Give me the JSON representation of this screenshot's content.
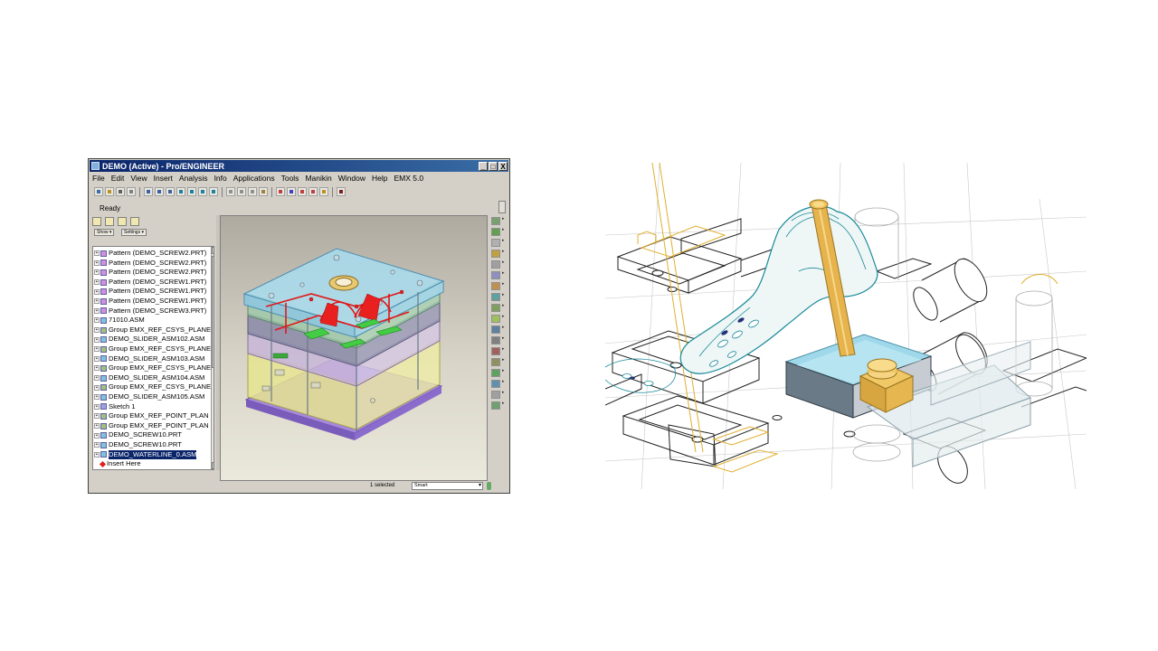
{
  "window": {
    "title": "DEMO (Active) - Pro/ENGINEER",
    "controls": {
      "minimize": "_",
      "maximize": "□",
      "close": "X"
    }
  },
  "menu": [
    "File",
    "Edit",
    "View",
    "Insert",
    "Analysis",
    "Info",
    "Applications",
    "Tools",
    "Manikin",
    "Window",
    "Help",
    "EMX 5.0"
  ],
  "status_message": "Ready",
  "panel": {
    "show_label": "Show ▾",
    "settings_label": "Settings ▾"
  },
  "tree": [
    {
      "label": "Pattern (DEMO_SCREW2.PRT)",
      "icon": "pattern-icon"
    },
    {
      "label": "Pattern (DEMO_SCREW2.PRT)",
      "icon": "pattern-icon"
    },
    {
      "label": "Pattern (DEMO_SCREW2.PRT)",
      "icon": "pattern-icon"
    },
    {
      "label": "Pattern (DEMO_SCREW1.PRT)",
      "icon": "pattern-icon"
    },
    {
      "label": "Pattern (DEMO_SCREW1.PRT)",
      "icon": "pattern-icon"
    },
    {
      "label": "Pattern (DEMO_SCREW1.PRT)",
      "icon": "pattern-icon"
    },
    {
      "label": "Pattern (DEMO_SCREW3.PRT)",
      "icon": "pattern-icon"
    },
    {
      "label": "71010.ASM",
      "icon": "assembly-icon"
    },
    {
      "label": "Group EMX_REF_CSYS_PLANE",
      "icon": "group-icon"
    },
    {
      "label": "DEMO_SLIDER_ASM102.ASM",
      "icon": "assembly-icon"
    },
    {
      "label": "Group EMX_REF_CSYS_PLANE",
      "icon": "group-icon"
    },
    {
      "label": "DEMO_SLIDER_ASM103.ASM",
      "icon": "assembly-icon"
    },
    {
      "label": "Group EMX_REF_CSYS_PLANE",
      "icon": "group-icon"
    },
    {
      "label": "DEMO_SLIDER_ASM104.ASM",
      "icon": "assembly-icon"
    },
    {
      "label": "Group EMX_REF_CSYS_PLANE",
      "icon": "group-icon"
    },
    {
      "label": "DEMO_SLIDER_ASM105.ASM",
      "icon": "assembly-icon"
    },
    {
      "label": "Sketch 1",
      "icon": "sketch-icon"
    },
    {
      "label": "Group EMX_REF_POINT_PLAN",
      "icon": "group-icon"
    },
    {
      "label": "Group EMX_REF_POINT_PLAN",
      "icon": "group-icon"
    },
    {
      "label": "DEMO_SCREW10.PRT",
      "icon": "part-icon"
    },
    {
      "label": "DEMO_SCREW10.PRT",
      "icon": "part-icon"
    },
    {
      "label": "DEMO_WATERLINE_0.ASM",
      "icon": "assembly-icon",
      "selected": true
    },
    {
      "label": "Insert Here",
      "icon": "insert-here-icon"
    }
  ],
  "statusbar": {
    "selected": "1 selected",
    "filter": "Smart"
  },
  "colors": {
    "title_bar": "#0a246a",
    "plate_blue": "#9ed4e6",
    "plate_yellow": "#e6e490",
    "plate_violet": "#8e6ec8",
    "cooling_lines": "#e01818",
    "sliders": "#44cc44",
    "pin_gold": "#e6b34d"
  }
}
